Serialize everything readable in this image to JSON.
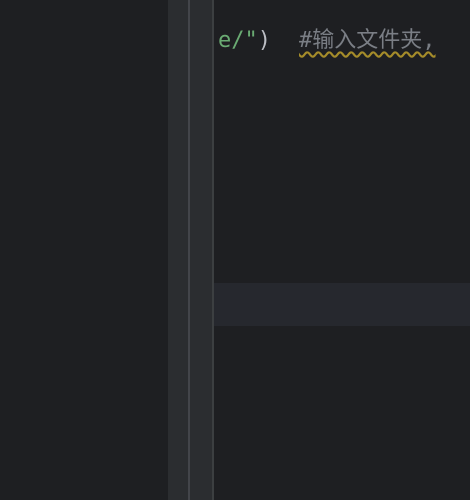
{
  "editor": {
    "visible_line": {
      "string_fragment": "e/\"",
      "closing_paren": ")",
      "comment": "#输入文件夹,"
    }
  },
  "colors": {
    "background": "#1e1f22",
    "gutter": "#2b2d30",
    "string": "#6aab73",
    "comment": "#7a7e85",
    "paren": "#bcbec4",
    "warning_underline": "#a58c2a",
    "current_line": "#26282e"
  }
}
